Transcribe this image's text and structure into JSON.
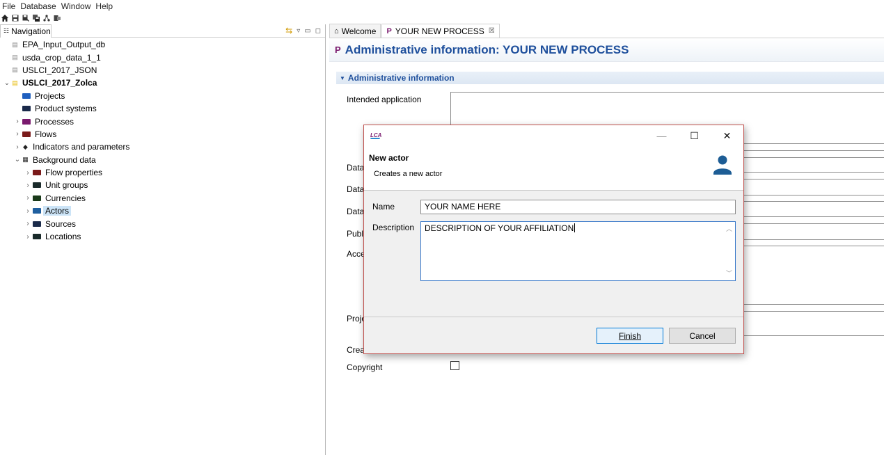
{
  "menu": {
    "items": [
      "File",
      "Database",
      "Window",
      "Help"
    ]
  },
  "toolbar": {
    "icons": [
      "home-icon",
      "save-icon",
      "save-as-icon",
      "save-all-icon",
      "network-icon",
      "import-icon"
    ]
  },
  "navigation": {
    "tab_label": "Navigation",
    "items": [
      {
        "label": "EPA_Input_Output_db",
        "type": "database",
        "level": 0,
        "expanded": null,
        "bold": false,
        "selected": false
      },
      {
        "label": "usda_crop_data_1_1",
        "type": "database",
        "level": 0,
        "expanded": null,
        "bold": false,
        "selected": false
      },
      {
        "label": "USLCI_2017_JSON",
        "type": "database",
        "level": 0,
        "expanded": null,
        "bold": false,
        "selected": false
      },
      {
        "label": "USLCI_2017_Zolca",
        "type": "database-active",
        "level": 0,
        "expanded": true,
        "bold": true,
        "selected": false
      },
      {
        "label": "Projects",
        "type": "folder",
        "color": "#1f5fbf",
        "level": 1,
        "expanded": null,
        "bold": false,
        "selected": false
      },
      {
        "label": "Product systems",
        "type": "folder",
        "color": "#1a2a4a",
        "level": 1,
        "expanded": null,
        "bold": false,
        "selected": false
      },
      {
        "label": "Processes",
        "type": "folder",
        "color": "#7a1a6e",
        "level": 1,
        "expanded": false,
        "bold": false,
        "selected": false
      },
      {
        "label": "Flows",
        "type": "folder",
        "color": "#7a1a1a",
        "level": 1,
        "expanded": false,
        "bold": false,
        "selected": false
      },
      {
        "label": "Indicators and parameters",
        "type": "indicator",
        "level": 1,
        "expanded": false,
        "bold": false,
        "selected": false
      },
      {
        "label": "Background data",
        "type": "grid",
        "level": 1,
        "expanded": true,
        "bold": false,
        "selected": false
      },
      {
        "label": "Flow properties",
        "type": "folder",
        "color": "#7a1a1a",
        "level": 2,
        "expanded": false,
        "bold": false,
        "selected": false
      },
      {
        "label": "Unit groups",
        "type": "folder",
        "color": "#1a2a2a",
        "level": 2,
        "expanded": false,
        "bold": false,
        "selected": false
      },
      {
        "label": "Currencies",
        "type": "folder",
        "color": "#1a3a1a",
        "level": 2,
        "expanded": false,
        "bold": false,
        "selected": false
      },
      {
        "label": "Actors",
        "type": "folder",
        "color": "#1f5f9f",
        "level": 2,
        "expanded": false,
        "bold": false,
        "selected": true
      },
      {
        "label": "Sources",
        "type": "folder",
        "color": "#1a2a4a",
        "level": 2,
        "expanded": false,
        "bold": false,
        "selected": false
      },
      {
        "label": "Locations",
        "type": "folder",
        "color": "#1a2a2a",
        "level": 2,
        "expanded": false,
        "bold": false,
        "selected": false
      }
    ]
  },
  "editor": {
    "tabs": [
      {
        "label": "Welcome",
        "icon": "home-icon",
        "active": false
      },
      {
        "label": "YOUR NEW PROCESS",
        "icon": "process-icon",
        "active": true,
        "closable": true
      }
    ],
    "header_title": "Administrative information: YOUR NEW PROCESS",
    "section_title": "Administrative information",
    "fields": [
      {
        "label": "Intended application"
      },
      {
        "label": "Data"
      },
      {
        "label": "Data"
      },
      {
        "label": "Data"
      },
      {
        "label": "Publi"
      },
      {
        "label": "Acce"
      },
      {
        "label": "Proje"
      },
      {
        "label": "Crea"
      },
      {
        "label": "Copyright"
      }
    ]
  },
  "dialog": {
    "logo": "LCA",
    "title": "New actor",
    "description": "Creates a new actor",
    "name_label": "Name",
    "name_value": "YOUR NAME HERE",
    "description_label": "Description",
    "description_value": "DESCRIPTION OF YOUR AFFILIATION",
    "finish_label": "Finish",
    "cancel_label": "Cancel"
  }
}
